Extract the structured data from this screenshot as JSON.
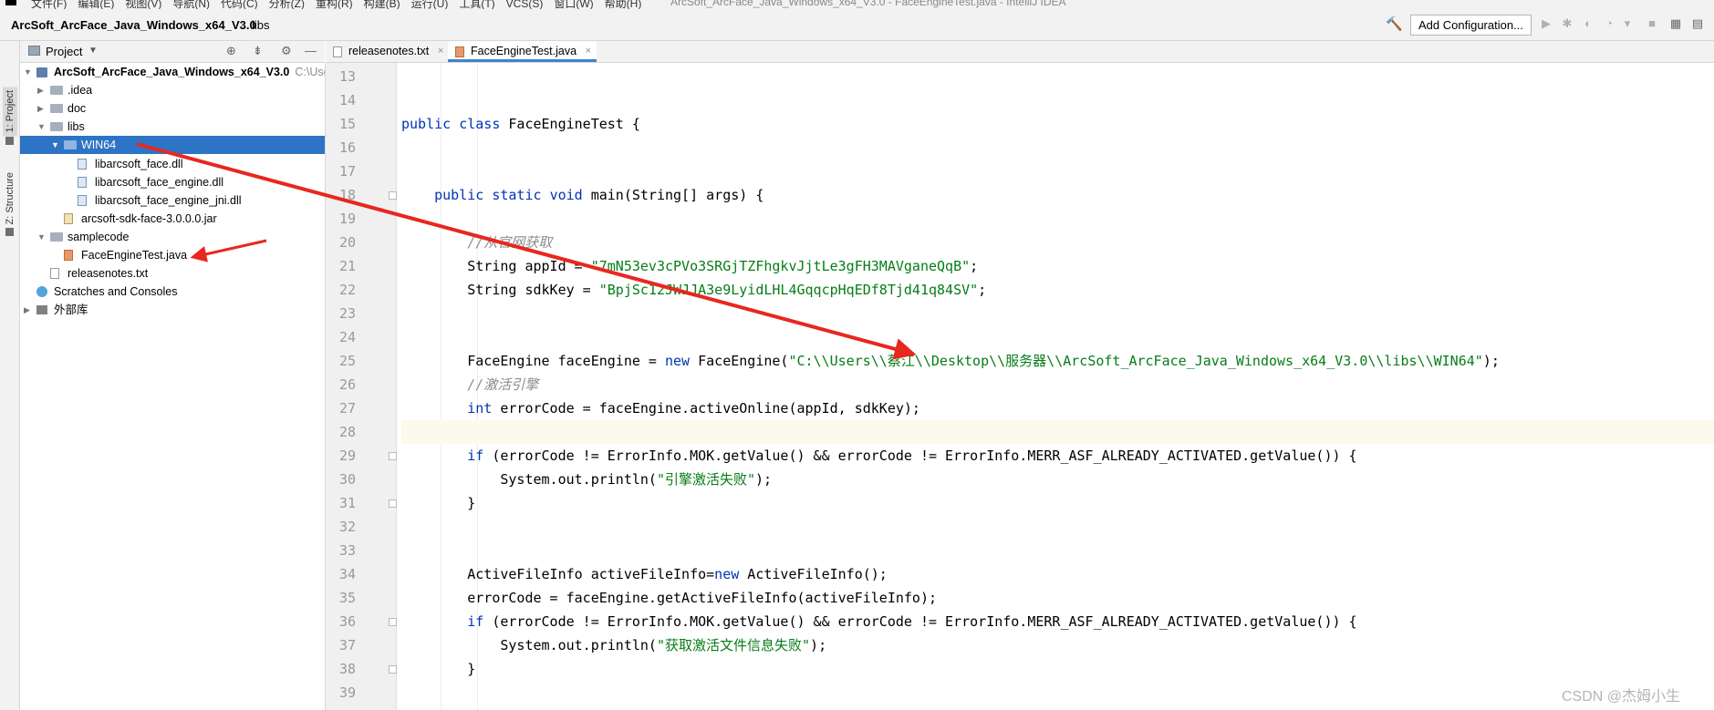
{
  "menubar": {
    "items": [
      "文件(F)",
      "编辑(E)",
      "视图(V)",
      "导航(N)",
      "代码(C)",
      "分析(Z)",
      "重构(R)",
      "构建(B)",
      "运行(U)",
      "工具(T)",
      "VCS(S)",
      "窗口(W)",
      "帮助(H)"
    ],
    "window_title": "ArcSoft_ArcFace_Java_Windows_x64_V3.0 - FaceEngineTest.java - IntelliJ IDEA"
  },
  "navbar": {
    "project_crumb": "ArcSoft_ArcFace_Java_Windows_x64_V3.0",
    "separator": "›",
    "folder_crumb": "libs",
    "add_configuration_label": "Add Configuration..."
  },
  "side_tabs": {
    "project": "1: Project",
    "structure": "Z: Structure"
  },
  "project_panel": {
    "title": "Project",
    "tree": [
      {
        "label": "ArcSoft_ArcFace_Java_Windows_x64_V3.0",
        "hint": "C:\\Users",
        "level": 0,
        "expanded": true,
        "icon": "module-icon",
        "bold": true
      },
      {
        "label": ".idea",
        "level": 1,
        "expanded": false,
        "icon": "folder-icon"
      },
      {
        "label": "doc",
        "level": 1,
        "expanded": false,
        "icon": "folder-icon"
      },
      {
        "label": "libs",
        "level": 1,
        "expanded": true,
        "icon": "folder-icon"
      },
      {
        "label": "WIN64",
        "level": 2,
        "expanded": true,
        "icon": "folder-icon",
        "selected": true
      },
      {
        "label": "libarcsoft_face.dll",
        "level": 3,
        "icon": "dll-file-icon"
      },
      {
        "label": "libarcsoft_face_engine.dll",
        "level": 3,
        "icon": "dll-file-icon"
      },
      {
        "label": "libarcsoft_face_engine_jni.dll",
        "level": 3,
        "icon": "dll-file-icon"
      },
      {
        "label": "arcsoft-sdk-face-3.0.0.0.jar",
        "level": 2,
        "icon": "jar-file-icon"
      },
      {
        "label": "samplecode",
        "level": 1,
        "expanded": true,
        "icon": "folder-icon"
      },
      {
        "label": "FaceEngineTest.java",
        "level": 2,
        "icon": "java-file-icon"
      },
      {
        "label": "releasenotes.txt",
        "level": 1,
        "icon": "text-file-icon"
      },
      {
        "label": "Scratches and Consoles",
        "level": 0,
        "icon": "scratches-icon"
      },
      {
        "label": "外部库",
        "level": 0,
        "expanded": false,
        "icon": "library-icon"
      }
    ]
  },
  "editor": {
    "tabs": [
      {
        "label": "releasenotes.txt",
        "active": false
      },
      {
        "label": "FaceEngineTest.java",
        "active": true
      }
    ],
    "lines": [
      {
        "n": "13",
        "text": ""
      },
      {
        "n": "14",
        "text": ""
      },
      {
        "n": "15",
        "text": "public class FaceEngineTest {"
      },
      {
        "n": "16",
        "text": ""
      },
      {
        "n": "17",
        "text": ""
      },
      {
        "n": "18",
        "text": "    public static void main(String[] args) {"
      },
      {
        "n": "19",
        "text": ""
      },
      {
        "n": "20",
        "text": "        //从官网获取"
      },
      {
        "n": "21",
        "text": "        String appId = \"7mN53ev3cPVo3SRGjTZFhgkvJjtLe3gFH3MAVganeQqB\";"
      },
      {
        "n": "22",
        "text": "        String sdkKey = \"BpjSc12JWJJA3e9LyidLHL4GqqcpHqEDf8Tjd41q84SV\";"
      },
      {
        "n": "23",
        "text": ""
      },
      {
        "n": "24",
        "text": ""
      },
      {
        "n": "25",
        "text": "        FaceEngine faceEngine = new FaceEngine(\"C:\\\\Users\\\\蔡江\\\\Desktop\\\\服务器\\\\ArcSoft_ArcFace_Java_Windows_x64_V3.0\\\\libs\\\\WIN64\");"
      },
      {
        "n": "26",
        "text": "        //激活引擎"
      },
      {
        "n": "27",
        "text": "        int errorCode = faceEngine.activeOnline(appId, sdkKey);"
      },
      {
        "n": "28",
        "text": "",
        "current": true
      },
      {
        "n": "29",
        "text": "        if (errorCode != ErrorInfo.MOK.getValue() && errorCode != ErrorInfo.MERR_ASF_ALREADY_ACTIVATED.getValue()) {"
      },
      {
        "n": "30",
        "text": "            System.out.println(\"引擎激活失败\");"
      },
      {
        "n": "31",
        "text": "        }"
      },
      {
        "n": "32",
        "text": ""
      },
      {
        "n": "33",
        "text": ""
      },
      {
        "n": "34",
        "text": "        ActiveFileInfo activeFileInfo=new ActiveFileInfo();"
      },
      {
        "n": "35",
        "text": "        errorCode = faceEngine.getActiveFileInfo(activeFileInfo);"
      },
      {
        "n": "36",
        "text": "        if (errorCode != ErrorInfo.MOK.getValue() && errorCode != ErrorInfo.MERR_ASF_ALREADY_ACTIVATED.getValue()) {"
      },
      {
        "n": "37",
        "text": "            System.out.println(\"获取激活文件信息失败\");"
      },
      {
        "n": "38",
        "text": "        }"
      },
      {
        "n": "39",
        "text": ""
      }
    ]
  },
  "watermark": "CSDN @杰姆小生",
  "colors": {
    "selection": "#2d74c4",
    "keyword": "#0033b3",
    "string": "#067d17",
    "comment": "#8c8c8c",
    "annotation_arrow": "#e8271f"
  }
}
